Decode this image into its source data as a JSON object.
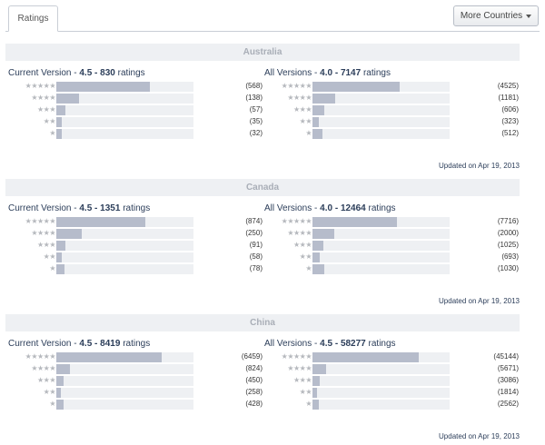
{
  "tabs": {
    "ratings_label": "Ratings"
  },
  "more_countries": {
    "label": "More Countries"
  },
  "star_glyphs": [
    "★★★★★",
    "★★★★",
    "★★★",
    "★★",
    "★"
  ],
  "colors": {
    "bar_fill": "#b6bccb",
    "bar_track": "#eef0f3",
    "header_bg": "#eef0f3"
  },
  "sections": [
    {
      "country": "Australia",
      "current": {
        "prefix": "Current Version",
        "sep": " - ",
        "score": "4.5",
        "dash": " - ",
        "count": "830",
        "suffix": " ratings",
        "bars": [
          {
            "count": "(568)",
            "ratio": 0.684
          },
          {
            "count": "(138)",
            "ratio": 0.166
          },
          {
            "count": "(57)",
            "ratio": 0.069
          },
          {
            "count": "(35)",
            "ratio": 0.042
          },
          {
            "count": "(32)",
            "ratio": 0.039
          }
        ]
      },
      "all": {
        "prefix": "All Versions",
        "sep": " - ",
        "score": "4.0",
        "dash": " - ",
        "count": "7147",
        "suffix": " ratings",
        "bars": [
          {
            "count": "(4525)",
            "ratio": 0.633
          },
          {
            "count": "(1181)",
            "ratio": 0.165
          },
          {
            "count": "(606)",
            "ratio": 0.085
          },
          {
            "count": "(323)",
            "ratio": 0.045
          },
          {
            "count": "(512)",
            "ratio": 0.072
          }
        ]
      },
      "updated": "Updated on Apr 19, 2013"
    },
    {
      "country": "Canada",
      "current": {
        "prefix": "Current Version",
        "sep": " - ",
        "score": "4.5",
        "dash": " - ",
        "count": "1351",
        "suffix": " ratings",
        "bars": [
          {
            "count": "(874)",
            "ratio": 0.647
          },
          {
            "count": "(250)",
            "ratio": 0.185
          },
          {
            "count": "(91)",
            "ratio": 0.067
          },
          {
            "count": "(58)",
            "ratio": 0.043
          },
          {
            "count": "(78)",
            "ratio": 0.058
          }
        ]
      },
      "all": {
        "prefix": "All Versions",
        "sep": " - ",
        "score": "4.0",
        "dash": " - ",
        "count": "12464",
        "suffix": " ratings",
        "bars": [
          {
            "count": "(7716)",
            "ratio": 0.619
          },
          {
            "count": "(2000)",
            "ratio": 0.16
          },
          {
            "count": "(1025)",
            "ratio": 0.082
          },
          {
            "count": "(693)",
            "ratio": 0.056
          },
          {
            "count": "(1030)",
            "ratio": 0.083
          }
        ]
      },
      "updated": "Updated on Apr 19, 2013"
    },
    {
      "country": "China",
      "current": {
        "prefix": "Current Version",
        "sep": " - ",
        "score": "4.5",
        "dash": " - ",
        "count": "8419",
        "suffix": " ratings",
        "bars": [
          {
            "count": "(6459)",
            "ratio": 0.767
          },
          {
            "count": "(824)",
            "ratio": 0.098
          },
          {
            "count": "(450)",
            "ratio": 0.053
          },
          {
            "count": "(258)",
            "ratio": 0.031
          },
          {
            "count": "(428)",
            "ratio": 0.051
          }
        ]
      },
      "all": {
        "prefix": "All Versions",
        "sep": " - ",
        "score": "4.5",
        "dash": " - ",
        "count": "58277",
        "suffix": " ratings",
        "bars": [
          {
            "count": "(45144)",
            "ratio": 0.775
          },
          {
            "count": "(5671)",
            "ratio": 0.097
          },
          {
            "count": "(3086)",
            "ratio": 0.053
          },
          {
            "count": "(1814)",
            "ratio": 0.031
          },
          {
            "count": "(2562)",
            "ratio": 0.044
          }
        ]
      },
      "updated": "Updated on Apr 19, 2013"
    }
  ]
}
